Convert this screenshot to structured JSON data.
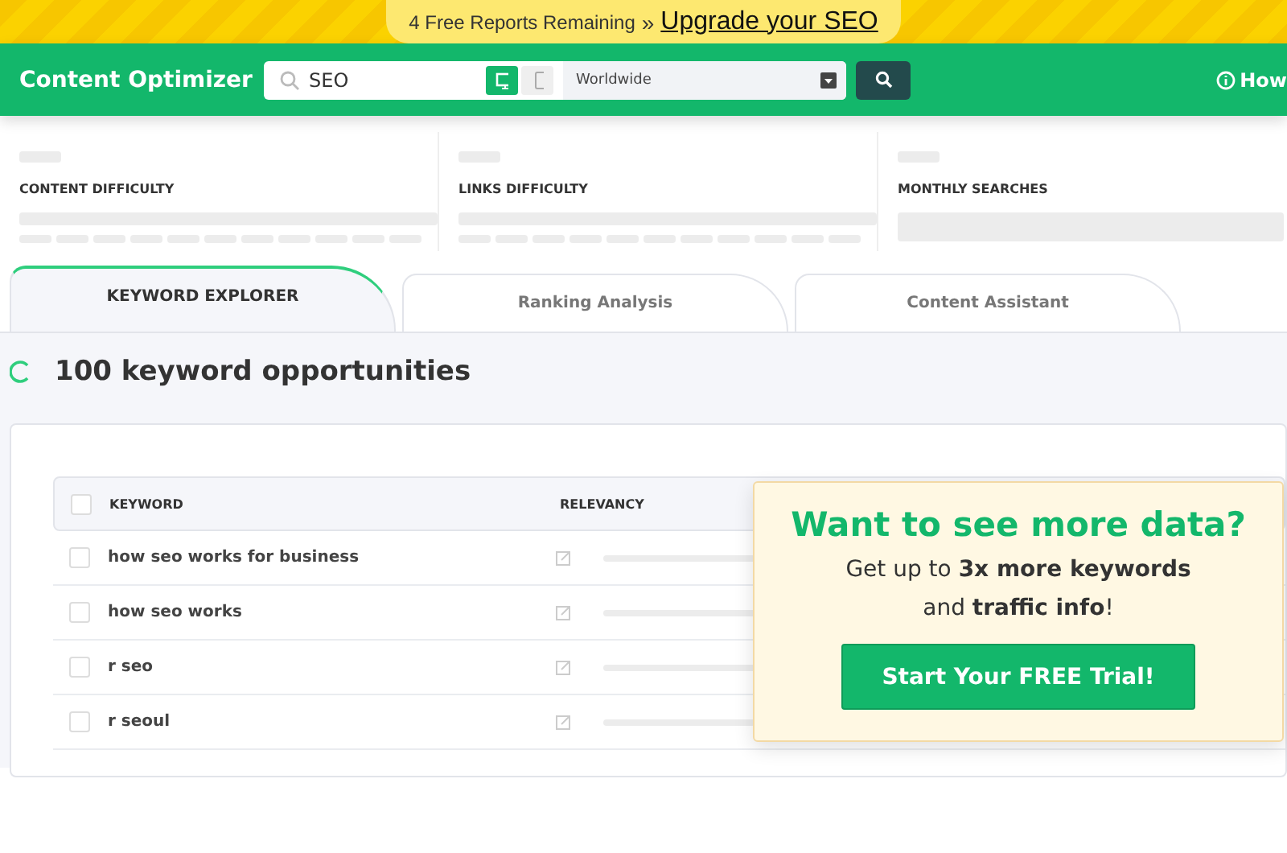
{
  "banner": {
    "text": "4 Free Reports Remaining",
    "separator": "»",
    "link": "Upgrade your SEO"
  },
  "header": {
    "title": "Content Optimizer",
    "search": {
      "value": "SEO"
    },
    "devices": [
      {
        "kind": "desktop",
        "selected": true
      },
      {
        "kind": "mobile",
        "selected": false
      }
    ],
    "location": "Worldwide",
    "help": "How"
  },
  "metrics": [
    {
      "label": "CONTENT DIFFICULTY",
      "kind": "bars"
    },
    {
      "label": "LINKS DIFFICULTY",
      "kind": "bars"
    },
    {
      "label": "MONTHLY SEARCHES",
      "kind": "block"
    }
  ],
  "tabs": [
    {
      "label": "KEYWORD EXPLORER",
      "selected": true
    },
    {
      "label": "Ranking Analysis",
      "selected": false
    },
    {
      "label": "Content Assistant",
      "selected": false
    }
  ],
  "heading": "100 keyword opportunities",
  "table": {
    "select_all_checked": false,
    "columns": [
      "KEYWORD",
      "RELEVANCY"
    ],
    "rows": [
      {
        "keyword": "how seo works for business",
        "checked": false
      },
      {
        "keyword": "how seo works",
        "checked": false
      },
      {
        "keyword": "r seo",
        "checked": false
      },
      {
        "keyword": "r seoul",
        "checked": false
      }
    ]
  },
  "promo": {
    "title": "Want to see more data?",
    "text": "Get up to **3x more keywords** and **traffic info**!",
    "button": "Start Your FREE Trial!"
  }
}
